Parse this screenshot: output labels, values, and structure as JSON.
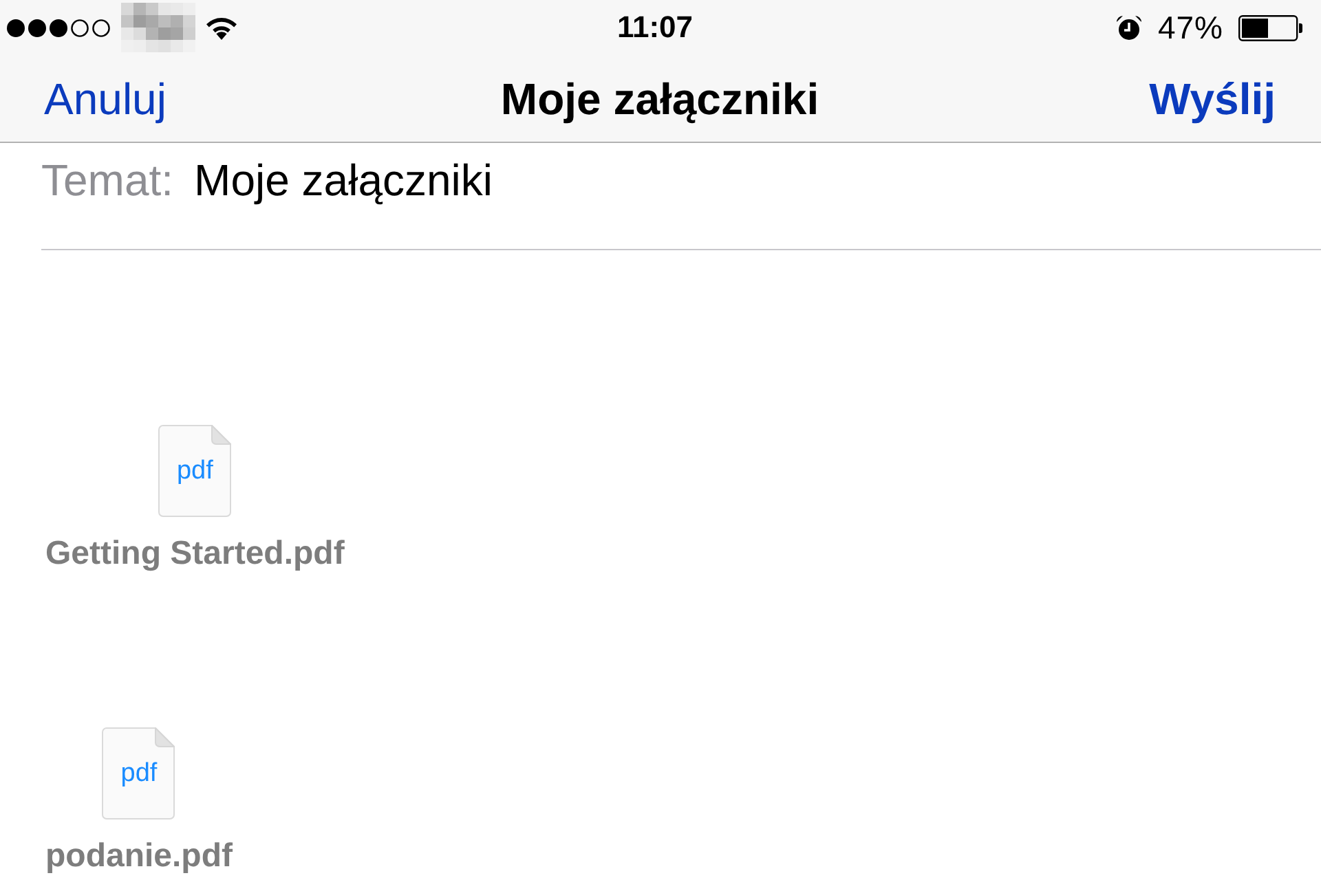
{
  "status_bar": {
    "time": "11:07",
    "battery_percent": "47%"
  },
  "nav_bar": {
    "cancel_button": "Anuluj",
    "title": "Moje załączniki",
    "send_button": "Wyślij"
  },
  "subject": {
    "label": "Temat:",
    "value": "Moje załączniki"
  },
  "attachments": [
    {
      "file_type": "pdf",
      "name": "Getting Started.pdf"
    },
    {
      "file_type": "pdf",
      "name": "podanie.pdf"
    }
  ]
}
